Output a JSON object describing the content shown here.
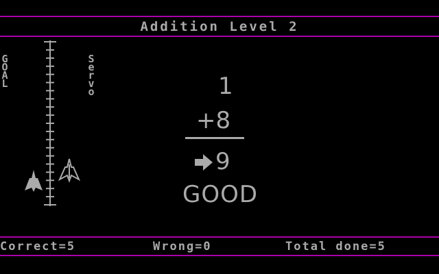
{
  "header": {
    "title": "Addition Level 2"
  },
  "sidebar": {
    "goal_label": "GOAL",
    "servo_label": "Servo",
    "icons": {
      "player_ship": "filled-jet-icon",
      "servo_ship": "outline-jet-icon"
    }
  },
  "problem": {
    "top_number": "1",
    "operator_line": "+8",
    "answer_arrow_icon": "right-arrow-icon",
    "answer": "9",
    "feedback": "GOOD"
  },
  "status": {
    "correct": "Correct=5",
    "wrong": "Wrong=0",
    "total": "Total done=5"
  },
  "colors": {
    "background": "#000000",
    "text": "#aaaaaa",
    "rule": "#aa00aa"
  }
}
